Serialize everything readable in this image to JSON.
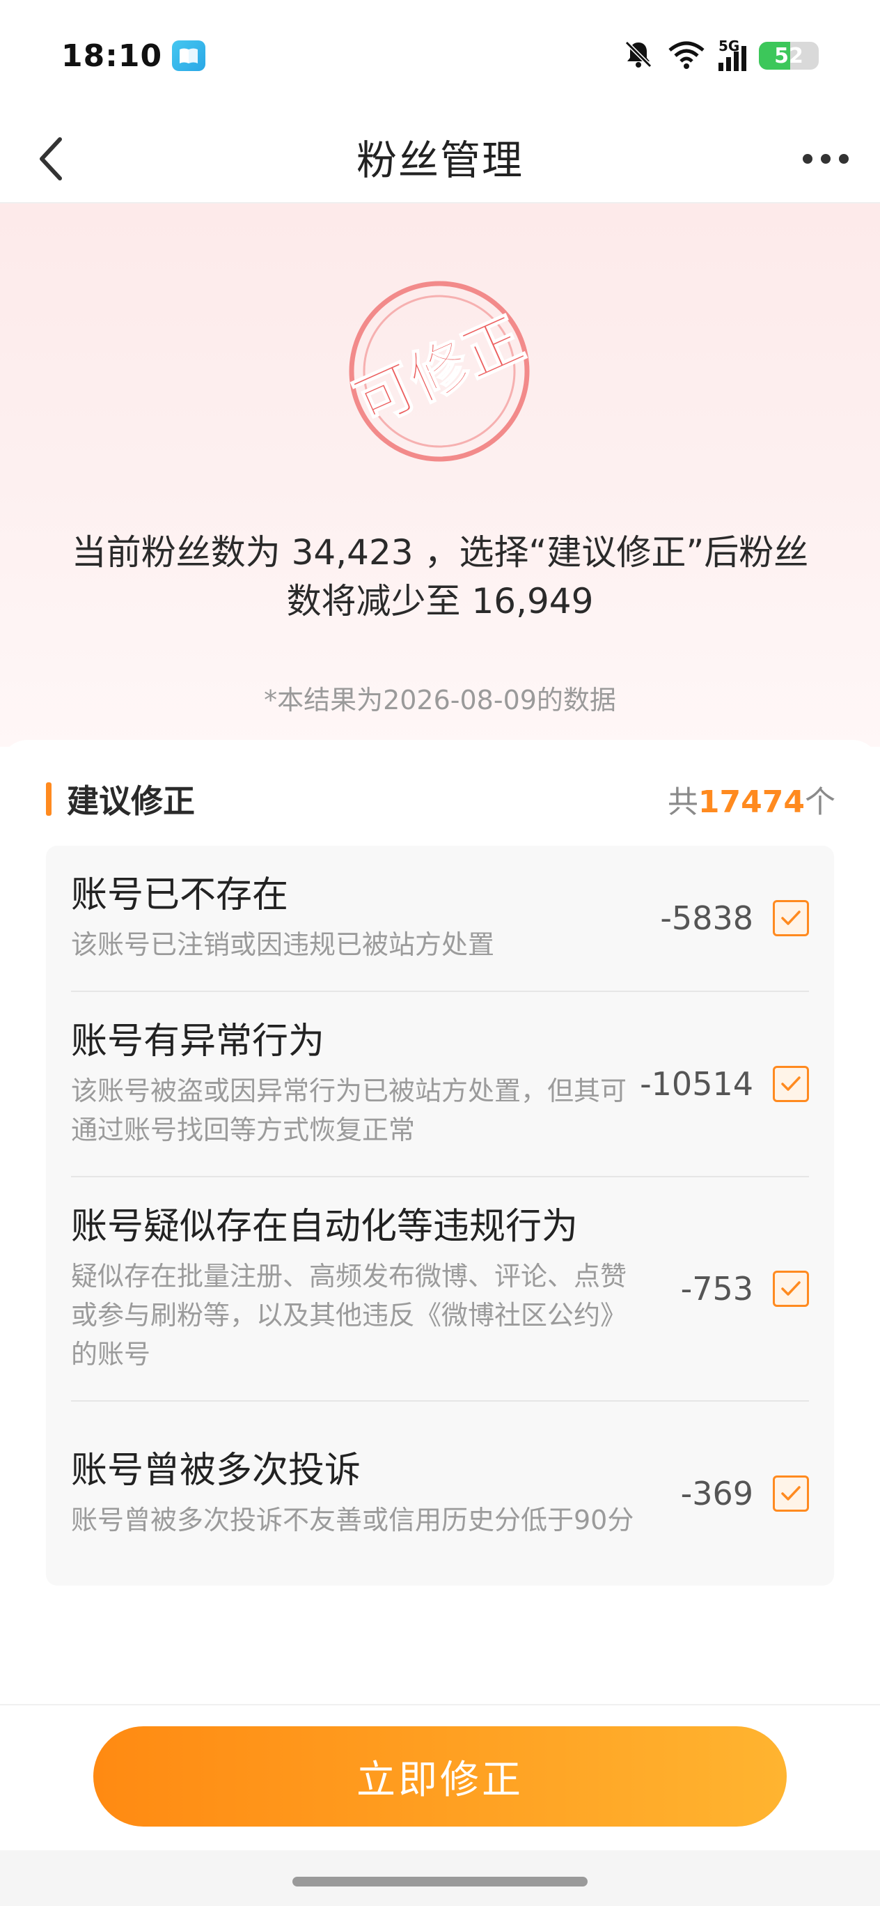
{
  "status_bar": {
    "time": "18:10",
    "network": "5G",
    "battery": "52",
    "icons": [
      "book-icon",
      "mute-bell-icon",
      "wifi-icon",
      "signal-icon",
      "battery-icon"
    ]
  },
  "nav": {
    "title": "粉丝管理",
    "back_icon": "chevron-left-icon",
    "more_icon": "more-dots-icon"
  },
  "hero": {
    "stamp_text": "可修正",
    "summary": "当前粉丝数为 34,423 ，选择“建议修正”后粉丝数将减少至 16,949",
    "note": "*本结果为2026-08-09的数据"
  },
  "section": {
    "title": "建议修正",
    "count_prefix": "共",
    "count_value": "17474",
    "count_suffix": "个"
  },
  "items": [
    {
      "title": "账号已不存在",
      "desc": "该账号已注销或因违规已被站方处置",
      "count": "-5838",
      "checked": true
    },
    {
      "title": "账号有异常行为",
      "desc": "该账号被盗或因异常行为已被站方处置，但其可通过账号找回等方式恢复正常",
      "count": "-10514",
      "checked": true
    },
    {
      "title": "账号疑似存在自动化等违规行为",
      "desc": "疑似存在批量注册、高频发布微博、评论、点赞或参与刷粉等，以及其他违反《微博社区公约》的账号",
      "count": "-753",
      "checked": true
    },
    {
      "title": "账号曾被多次投诉",
      "desc": "账号曾被多次投诉不友善或信用历史分低于90分",
      "count": "-369",
      "checked": true
    }
  ],
  "action": {
    "button_label": "立即修正"
  },
  "colors": {
    "accent": "#ff8a1f",
    "button_gradient_start": "#ff8a12",
    "button_gradient_end": "#ffb430",
    "stamp": "#f06a6a"
  }
}
